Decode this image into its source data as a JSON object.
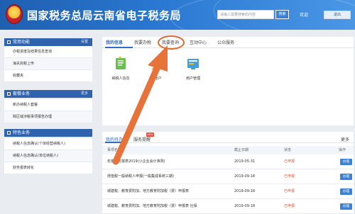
{
  "header": {
    "title": "国家税务总局云南省电子税务局",
    "search_placeholder": "请输入需要搜索的内容",
    "search_label": "搜索",
    "welcome": "欢迎",
    "logout_label": "退出"
  },
  "sidebar": {
    "sections": [
      {
        "title": "常用功能",
        "more": "设置",
        "items": [
          "办税进度及结果信息查询",
          "海关完税上传",
          "收藏夹"
        ]
      },
      {
        "title": "套餐业务",
        "more": "更多",
        "items": [
          "新办纳税人套餐",
          "跨区域涉税事项报告办理"
        ]
      },
      {
        "title": "特色业务",
        "more": "",
        "items": [
          "纳税人信息确认(个体经营纳税人)",
          "纳税人信息确认(单位纳税人)",
          "财务报表转化"
        ]
      }
    ]
  },
  "main": {
    "tabs": [
      "我的信息",
      "我要办税",
      "我要查询",
      "互动中心",
      "公众服务"
    ],
    "active_tab": "我的信息",
    "tiles": [
      {
        "label": "纳税人信息",
        "icon": "taxpayer-info-icon"
      },
      {
        "label": "子账户",
        "icon": "sub-account-icon"
      },
      {
        "label": "用户管理",
        "icon": "user-management-icon"
      }
    ]
  },
  "list": {
    "tabs": [
      "我的待办",
      "服务提醒"
    ],
    "new_badge": "NEW",
    "more": "更多",
    "columns": [
      "事项名称",
      "截止日期",
      "状态",
      "操作"
    ],
    "rows": [
      {
        "name": "年度财务报表2019(小企业会计准则)",
        "date": "2019-05-31",
        "status": "已申报",
        "action": "办理"
      },
      {
        "name": "增值税一般纳税人申报(一般集成系统三期)",
        "date": "2019-09-18",
        "status": "已申报",
        "action": "办理"
      },
      {
        "name": "城建税、教育费附加、地方教育附加税（费）申报表",
        "date": "2019-09-18",
        "status": "已申报",
        "action": "办理"
      },
      {
        "name": "城建税、教育费附加、地方教育附加税（费）申报表 社保",
        "date": "2019-09-18",
        "status": "已申报",
        "action": "办理"
      }
    ]
  },
  "colors": {
    "header_blue": "#2a78d2",
    "accent_blue": "#2f6cc2",
    "arrow_orange": "#e8733a",
    "status_red": "#e4532b"
  }
}
